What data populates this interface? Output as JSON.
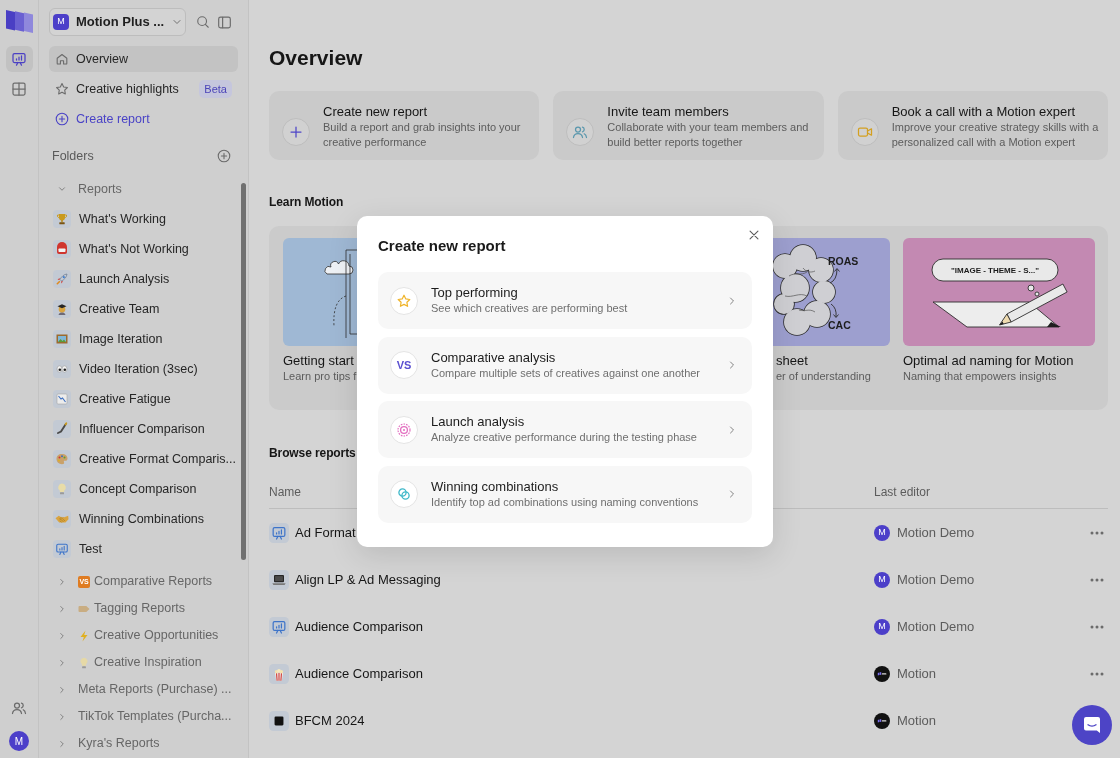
{
  "rail": {
    "items": [
      {
        "selected": true
      },
      {
        "selected": false
      }
    ],
    "avatar": "M"
  },
  "sidebar": {
    "workspace": {
      "avatar": "M",
      "name": "Motion Plus ..."
    },
    "nav": [
      {
        "kind": "page",
        "label": "Overview",
        "selected": true
      },
      {
        "kind": "page",
        "label": "Creative highlights",
        "selected": false,
        "badge": "Beta"
      },
      {
        "kind": "action",
        "label": "Create report",
        "selected": false
      }
    ],
    "folders_title": "Folders",
    "tree": [
      {
        "label": "Reports",
        "expanded": true,
        "children": [
          {
            "label": "What's Working"
          },
          {
            "label": "What's Not Working"
          },
          {
            "label": "Launch Analysis"
          },
          {
            "label": "Creative Team"
          },
          {
            "label": "Image Iteration"
          },
          {
            "label": "Video Iteration (3sec)"
          },
          {
            "label": "Creative Fatigue"
          },
          {
            "label": "Influencer Comparison"
          },
          {
            "label": "Creative Format Comparis..."
          },
          {
            "label": "Concept Comparison"
          },
          {
            "label": "Winning Combinations"
          },
          {
            "label": "Test"
          }
        ]
      },
      {
        "label": "Comparative Reports",
        "expanded": false,
        "icon_text": "VS"
      },
      {
        "label": "Tagging Reports",
        "expanded": false
      },
      {
        "label": "Creative Opportunities",
        "expanded": false
      },
      {
        "label": "Creative Inspiration",
        "expanded": false
      },
      {
        "label": "Meta Reports (Purchase) ...",
        "expanded": false
      },
      {
        "label": "TikTok Templates (Purcha...",
        "expanded": false
      },
      {
        "label": "Kyra's Reports",
        "expanded": false
      }
    ]
  },
  "main": {
    "title": "Overview",
    "actions": [
      {
        "title": "Create new report",
        "description": "Build a report and grab insights into your creative performance"
      },
      {
        "title": "Invite team members",
        "description": "Collaborate with your team members and build better reports together"
      },
      {
        "title": "Book a call with a Motion expert",
        "description": "Improve your creative strategy skills with a personalized call with a Motion expert"
      }
    ],
    "learn": {
      "title": "Learn Motion",
      "cards": [
        {
          "title": "Getting start",
          "subtitle": "Learn pro tips f"
        },
        {
          "title": "sheet",
          "subtitle": "er of understanding",
          "labels": [
            "ROAS",
            "CAC"
          ]
        },
        {
          "title": "Optimal ad naming for Motion",
          "subtitle": "Naming that empowers insights",
          "labels": [
            "\"IMAGE - THEME - S...\""
          ]
        }
      ]
    },
    "browse": {
      "title": "Browse reports",
      "columns": [
        "Name",
        "Last editor"
      ],
      "rows": [
        {
          "name": "Ad Format",
          "avatar": "M",
          "editor": "Motion Demo",
          "more": true
        },
        {
          "name": "Align LP & Ad Messaging",
          "avatar": "M",
          "editor": "Motion Demo",
          "more": true
        },
        {
          "name": "Audience Comparison",
          "avatar": "M",
          "editor": "Motion Demo",
          "more": true
        },
        {
          "name": "Audience Comparison",
          "editor": "Motion",
          "more": true
        },
        {
          "name": "BFCM 2024",
          "editor": "Motion",
          "more": false
        }
      ]
    }
  },
  "modal": {
    "title": "Create new report",
    "options": [
      {
        "title": "Top performing",
        "description": "See which creatives are performing best"
      },
      {
        "title": "Comparative analysis",
        "description": "Compare multiple sets of creatives against one another",
        "icon_text": "VS"
      },
      {
        "title": "Launch analysis",
        "description": "Analyze creative performance during the testing phase"
      },
      {
        "title": "Winning combinations",
        "description": "Identify top ad combinations using naming conventions"
      }
    ]
  }
}
